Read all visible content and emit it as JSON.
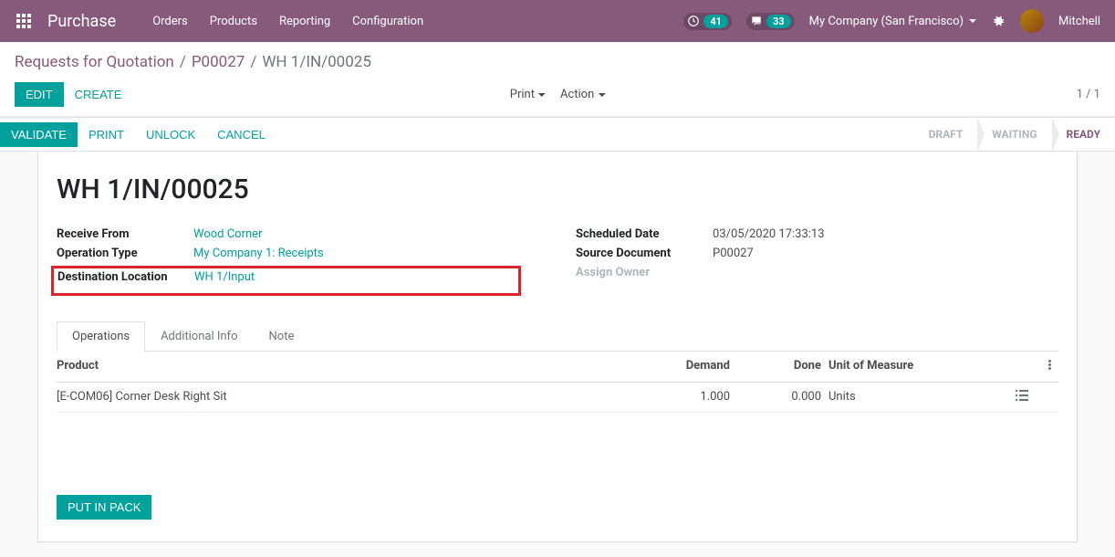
{
  "header": {
    "app": "Purchase",
    "menu": [
      "Orders",
      "Products",
      "Reporting",
      "Configuration"
    ],
    "clock_badge": "41",
    "chat_badge": "33",
    "company": "My Company (San Francisco)",
    "user": "Mitchell"
  },
  "breadcrumb": {
    "rfq": "Requests for Quotation",
    "po": "P00027",
    "current": "WH 1/IN/00025"
  },
  "controls": {
    "edit": "Edit",
    "create": "Create",
    "print": "Print",
    "action": "Action",
    "pager": "1 / 1"
  },
  "statusbar": {
    "validate": "Validate",
    "print": "Print",
    "unlock": "Unlock",
    "cancel": "Cancel",
    "stages": [
      "Draft",
      "Waiting",
      "Ready"
    ]
  },
  "record": {
    "title": "WH 1/IN/00025",
    "receive_from_label": "Receive From",
    "receive_from": "Wood Corner",
    "operation_type_label": "Operation Type",
    "operation_type": "My Company 1: Receipts",
    "dest_loc_label": "Destination Location",
    "dest_loc": "WH 1/Input",
    "scheduled_date_label": "Scheduled Date",
    "scheduled_date": "03/05/2020 17:33:13",
    "source_doc_label": "Source Document",
    "source_doc": "P00027",
    "assign_owner_label": "Assign Owner"
  },
  "tabs": {
    "operations": "Operations",
    "additional": "Additional Info",
    "note": "Note"
  },
  "grid": {
    "headers": {
      "product": "Product",
      "demand": "Demand",
      "done": "Done",
      "uom": "Unit of Measure"
    },
    "rows": [
      {
        "product": "[E-COM06] Corner Desk Right Sit",
        "demand": "1.000",
        "done": "0.000",
        "uom": "Units"
      }
    ]
  },
  "put_in_pack": "Put in Pack"
}
